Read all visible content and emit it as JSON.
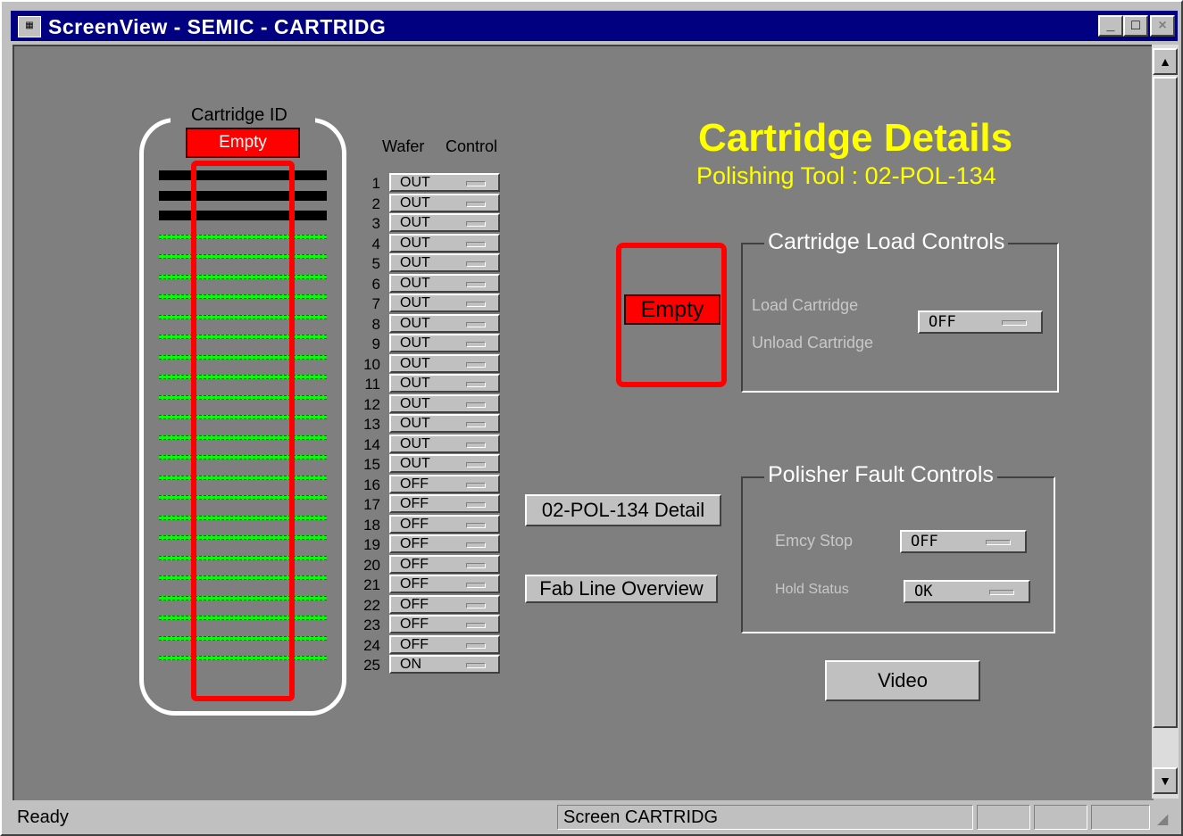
{
  "window": {
    "title": "ScreenView - SEMIC - CARTRIDG",
    "icon": "app-icon",
    "minimize": "_",
    "maximize": "□",
    "close": "×"
  },
  "cartridge": {
    "label": "Cartridge ID",
    "id_value": "Empty",
    "slot_states": [
      "black",
      "black",
      "black",
      "green",
      "green",
      "green",
      "green",
      "green",
      "green",
      "green",
      "green",
      "green",
      "green",
      "green",
      "green",
      "green",
      "green",
      "green",
      "green",
      "green",
      "green",
      "green",
      "green",
      "green",
      "green"
    ]
  },
  "wafer_table": {
    "header_wafer": "Wafer",
    "header_control": "Control",
    "rows": [
      {
        "num": "1",
        "state": "OUT"
      },
      {
        "num": "2",
        "state": "OUT"
      },
      {
        "num": "3",
        "state": "OUT"
      },
      {
        "num": "4",
        "state": "OUT"
      },
      {
        "num": "5",
        "state": "OUT"
      },
      {
        "num": "6",
        "state": "OUT"
      },
      {
        "num": "7",
        "state": "OUT"
      },
      {
        "num": "8",
        "state": "OUT"
      },
      {
        "num": "9",
        "state": "OUT"
      },
      {
        "num": "10",
        "state": "OUT"
      },
      {
        "num": "11",
        "state": "OUT"
      },
      {
        "num": "12",
        "state": "OUT"
      },
      {
        "num": "13",
        "state": "OUT"
      },
      {
        "num": "14",
        "state": "OUT"
      },
      {
        "num": "15",
        "state": "OUT"
      },
      {
        "num": "16",
        "state": "OFF"
      },
      {
        "num": "17",
        "state": "OFF"
      },
      {
        "num": "18",
        "state": "OFF"
      },
      {
        "num": "19",
        "state": "OFF"
      },
      {
        "num": "20",
        "state": "OFF"
      },
      {
        "num": "21",
        "state": "OFF"
      },
      {
        "num": "22",
        "state": "OFF"
      },
      {
        "num": "23",
        "state": "OFF"
      },
      {
        "num": "24",
        "state": "OFF"
      },
      {
        "num": "25",
        "state": "ON"
      }
    ]
  },
  "details": {
    "title": "Cartridge Details",
    "subtitle": "Polishing Tool : 02-POL-134",
    "status_box": "Empty"
  },
  "load_controls": {
    "title": "Cartridge Load Controls",
    "load_label": "Load Cartridge",
    "unload_label": "Unload Cartridge",
    "toggle_value": "OFF"
  },
  "fault_controls": {
    "title": "Polisher Fault Controls",
    "emergency_label": "Emcy Stop",
    "emergency_value": "OFF",
    "hold_label": "Hold Status",
    "hold_value": "OK"
  },
  "buttons": {
    "detail": "02-POL-134 Detail",
    "overview": "Fab Line Overview",
    "video": "Video"
  },
  "statusbar": {
    "left": "Ready",
    "screen": "Screen  CARTRIDG"
  },
  "colors": {
    "background": "#7f7f7f",
    "accent_yellow": "#ffff00",
    "alarm_red": "#ff0000",
    "slot_green": "#00ff00",
    "titlebar": "#000080"
  }
}
